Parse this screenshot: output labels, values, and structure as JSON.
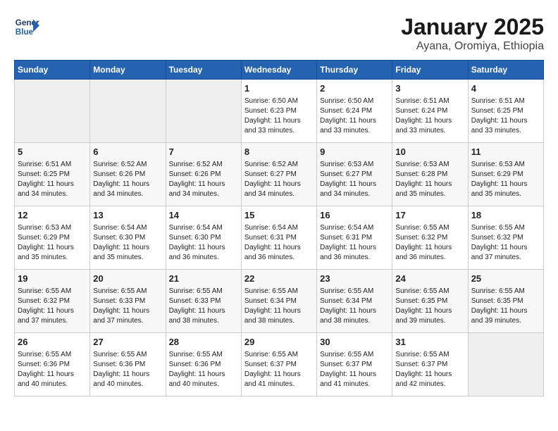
{
  "header": {
    "logo_line1": "General",
    "logo_line2": "Blue",
    "title": "January 2025",
    "subtitle": "Ayana, Oromiya, Ethiopia"
  },
  "weekdays": [
    "Sunday",
    "Monday",
    "Tuesday",
    "Wednesday",
    "Thursday",
    "Friday",
    "Saturday"
  ],
  "weeks": [
    [
      {
        "day": "",
        "info": ""
      },
      {
        "day": "",
        "info": ""
      },
      {
        "day": "",
        "info": ""
      },
      {
        "day": "1",
        "info": "Sunrise: 6:50 AM\nSunset: 6:23 PM\nDaylight: 11 hours\nand 33 minutes."
      },
      {
        "day": "2",
        "info": "Sunrise: 6:50 AM\nSunset: 6:24 PM\nDaylight: 11 hours\nand 33 minutes."
      },
      {
        "day": "3",
        "info": "Sunrise: 6:51 AM\nSunset: 6:24 PM\nDaylight: 11 hours\nand 33 minutes."
      },
      {
        "day": "4",
        "info": "Sunrise: 6:51 AM\nSunset: 6:25 PM\nDaylight: 11 hours\nand 33 minutes."
      }
    ],
    [
      {
        "day": "5",
        "info": "Sunrise: 6:51 AM\nSunset: 6:25 PM\nDaylight: 11 hours\nand 34 minutes."
      },
      {
        "day": "6",
        "info": "Sunrise: 6:52 AM\nSunset: 6:26 PM\nDaylight: 11 hours\nand 34 minutes."
      },
      {
        "day": "7",
        "info": "Sunrise: 6:52 AM\nSunset: 6:26 PM\nDaylight: 11 hours\nand 34 minutes."
      },
      {
        "day": "8",
        "info": "Sunrise: 6:52 AM\nSunset: 6:27 PM\nDaylight: 11 hours\nand 34 minutes."
      },
      {
        "day": "9",
        "info": "Sunrise: 6:53 AM\nSunset: 6:27 PM\nDaylight: 11 hours\nand 34 minutes."
      },
      {
        "day": "10",
        "info": "Sunrise: 6:53 AM\nSunset: 6:28 PM\nDaylight: 11 hours\nand 35 minutes."
      },
      {
        "day": "11",
        "info": "Sunrise: 6:53 AM\nSunset: 6:29 PM\nDaylight: 11 hours\nand 35 minutes."
      }
    ],
    [
      {
        "day": "12",
        "info": "Sunrise: 6:53 AM\nSunset: 6:29 PM\nDaylight: 11 hours\nand 35 minutes."
      },
      {
        "day": "13",
        "info": "Sunrise: 6:54 AM\nSunset: 6:30 PM\nDaylight: 11 hours\nand 35 minutes."
      },
      {
        "day": "14",
        "info": "Sunrise: 6:54 AM\nSunset: 6:30 PM\nDaylight: 11 hours\nand 36 minutes."
      },
      {
        "day": "15",
        "info": "Sunrise: 6:54 AM\nSunset: 6:31 PM\nDaylight: 11 hours\nand 36 minutes."
      },
      {
        "day": "16",
        "info": "Sunrise: 6:54 AM\nSunset: 6:31 PM\nDaylight: 11 hours\nand 36 minutes."
      },
      {
        "day": "17",
        "info": "Sunrise: 6:55 AM\nSunset: 6:32 PM\nDaylight: 11 hours\nand 36 minutes."
      },
      {
        "day": "18",
        "info": "Sunrise: 6:55 AM\nSunset: 6:32 PM\nDaylight: 11 hours\nand 37 minutes."
      }
    ],
    [
      {
        "day": "19",
        "info": "Sunrise: 6:55 AM\nSunset: 6:32 PM\nDaylight: 11 hours\nand 37 minutes."
      },
      {
        "day": "20",
        "info": "Sunrise: 6:55 AM\nSunset: 6:33 PM\nDaylight: 11 hours\nand 37 minutes."
      },
      {
        "day": "21",
        "info": "Sunrise: 6:55 AM\nSunset: 6:33 PM\nDaylight: 11 hours\nand 38 minutes."
      },
      {
        "day": "22",
        "info": "Sunrise: 6:55 AM\nSunset: 6:34 PM\nDaylight: 11 hours\nand 38 minutes."
      },
      {
        "day": "23",
        "info": "Sunrise: 6:55 AM\nSunset: 6:34 PM\nDaylight: 11 hours\nand 38 minutes."
      },
      {
        "day": "24",
        "info": "Sunrise: 6:55 AM\nSunset: 6:35 PM\nDaylight: 11 hours\nand 39 minutes."
      },
      {
        "day": "25",
        "info": "Sunrise: 6:55 AM\nSunset: 6:35 PM\nDaylight: 11 hours\nand 39 minutes."
      }
    ],
    [
      {
        "day": "26",
        "info": "Sunrise: 6:55 AM\nSunset: 6:36 PM\nDaylight: 11 hours\nand 40 minutes."
      },
      {
        "day": "27",
        "info": "Sunrise: 6:55 AM\nSunset: 6:36 PM\nDaylight: 11 hours\nand 40 minutes."
      },
      {
        "day": "28",
        "info": "Sunrise: 6:55 AM\nSunset: 6:36 PM\nDaylight: 11 hours\nand 40 minutes."
      },
      {
        "day": "29",
        "info": "Sunrise: 6:55 AM\nSunset: 6:37 PM\nDaylight: 11 hours\nand 41 minutes."
      },
      {
        "day": "30",
        "info": "Sunrise: 6:55 AM\nSunset: 6:37 PM\nDaylight: 11 hours\nand 41 minutes."
      },
      {
        "day": "31",
        "info": "Sunrise: 6:55 AM\nSunset: 6:37 PM\nDaylight: 11 hours\nand 42 minutes."
      },
      {
        "day": "",
        "info": ""
      }
    ]
  ]
}
